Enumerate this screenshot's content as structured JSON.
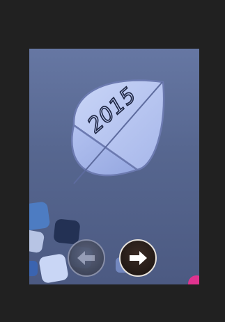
{
  "slide": {
    "year_text": "2015",
    "background_color": "#56668f",
    "leaf_color": "#b8c7f2",
    "leaf_outline_color": "#6c7ab0"
  },
  "navigation": {
    "previous_icon": "arrow-left-icon",
    "next_icon": "arrow-right-icon"
  },
  "colors": {
    "app_background": "#212121",
    "decor_tiles": [
      "#4d7cc2",
      "#233154",
      "#c9d6f5",
      "#5e86d0",
      "#e0338f"
    ]
  }
}
